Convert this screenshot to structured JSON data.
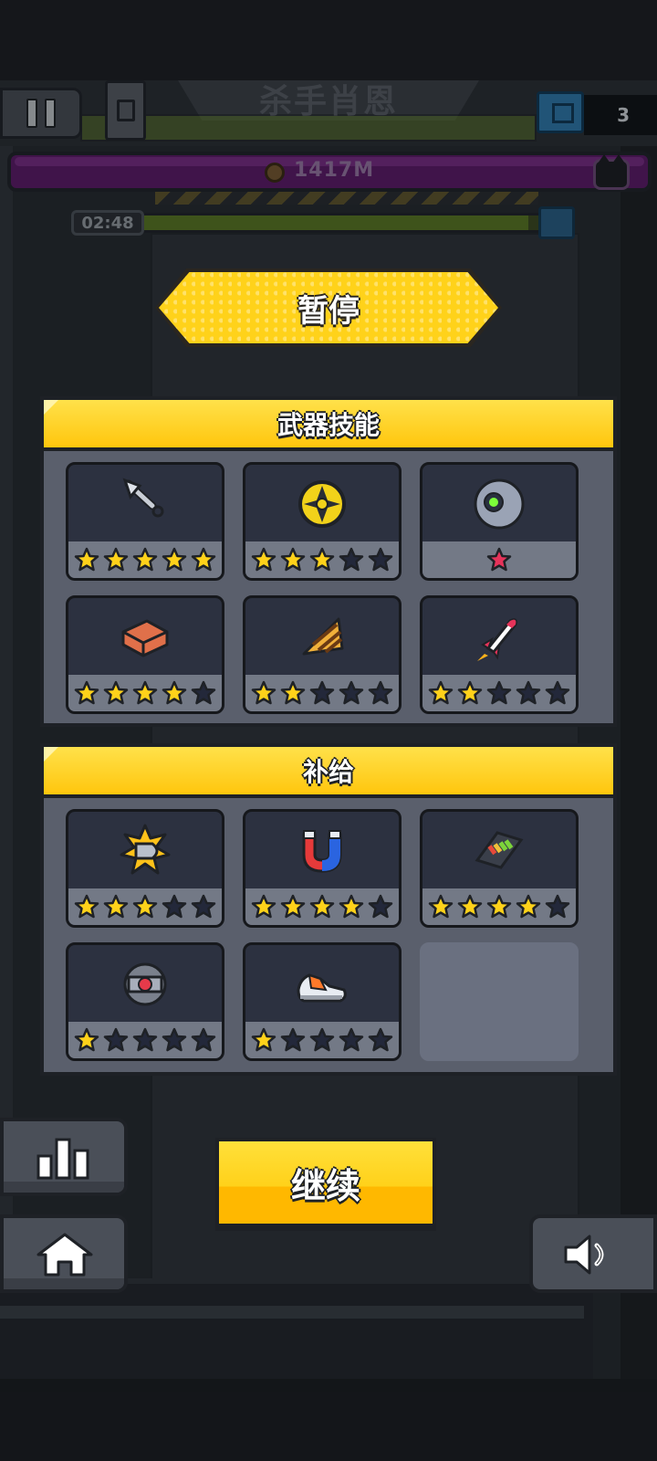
{
  "hud": {
    "boss_name": "杀手肖恩",
    "chest_count": "3",
    "distance": "1417M",
    "timer": "02:48",
    "timer_progress": 0.97
  },
  "pause": {
    "title": "暂停"
  },
  "weapons": {
    "title": "武器技能",
    "items": [
      {
        "icon": "kunai-icon",
        "stars": 5,
        "max": 5,
        "star_color": "#ffd21a"
      },
      {
        "icon": "shuriken-disc-icon",
        "stars": 3,
        "max": 5,
        "star_color": "#ffd21a"
      },
      {
        "icon": "orb-drone-icon",
        "stars": 1,
        "max": 1,
        "star_color": "#e6335a"
      },
      {
        "icon": "brick-icon",
        "stars": 4,
        "max": 5,
        "star_color": "#ffd21a"
      },
      {
        "icon": "drill-icon",
        "stars": 2,
        "max": 5,
        "star_color": "#ffd21a"
      },
      {
        "icon": "rocket-icon",
        "stars": 2,
        "max": 5,
        "star_color": "#ffd21a"
      }
    ]
  },
  "supplies": {
    "title": "补给",
    "items": [
      {
        "icon": "explosive-bullet-icon",
        "stars": 3,
        "max": 5,
        "star_color": "#ffd21a"
      },
      {
        "icon": "magnet-icon",
        "stars": 4,
        "max": 5,
        "star_color": "#ffd21a"
      },
      {
        "icon": "battery-icon",
        "stars": 4,
        "max": 5,
        "star_color": "#ffd21a"
      },
      {
        "icon": "armor-core-icon",
        "stars": 1,
        "max": 5,
        "star_color": "#ffd21a"
      },
      {
        "icon": "sneaker-icon",
        "stars": 1,
        "max": 5,
        "star_color": "#ffd21a"
      }
    ]
  },
  "buttons": {
    "continue": "继续",
    "stats_icon": "bar-chart-icon",
    "home_icon": "home-icon",
    "sound_icon": "speaker-icon"
  },
  "colors": {
    "accent_yellow": "#ffd21a",
    "distance_bar": "#5e1a6a",
    "panel_bg": "#5a5f6c",
    "slot_bg": "#2c3140",
    "star_empty": "#23283a"
  }
}
